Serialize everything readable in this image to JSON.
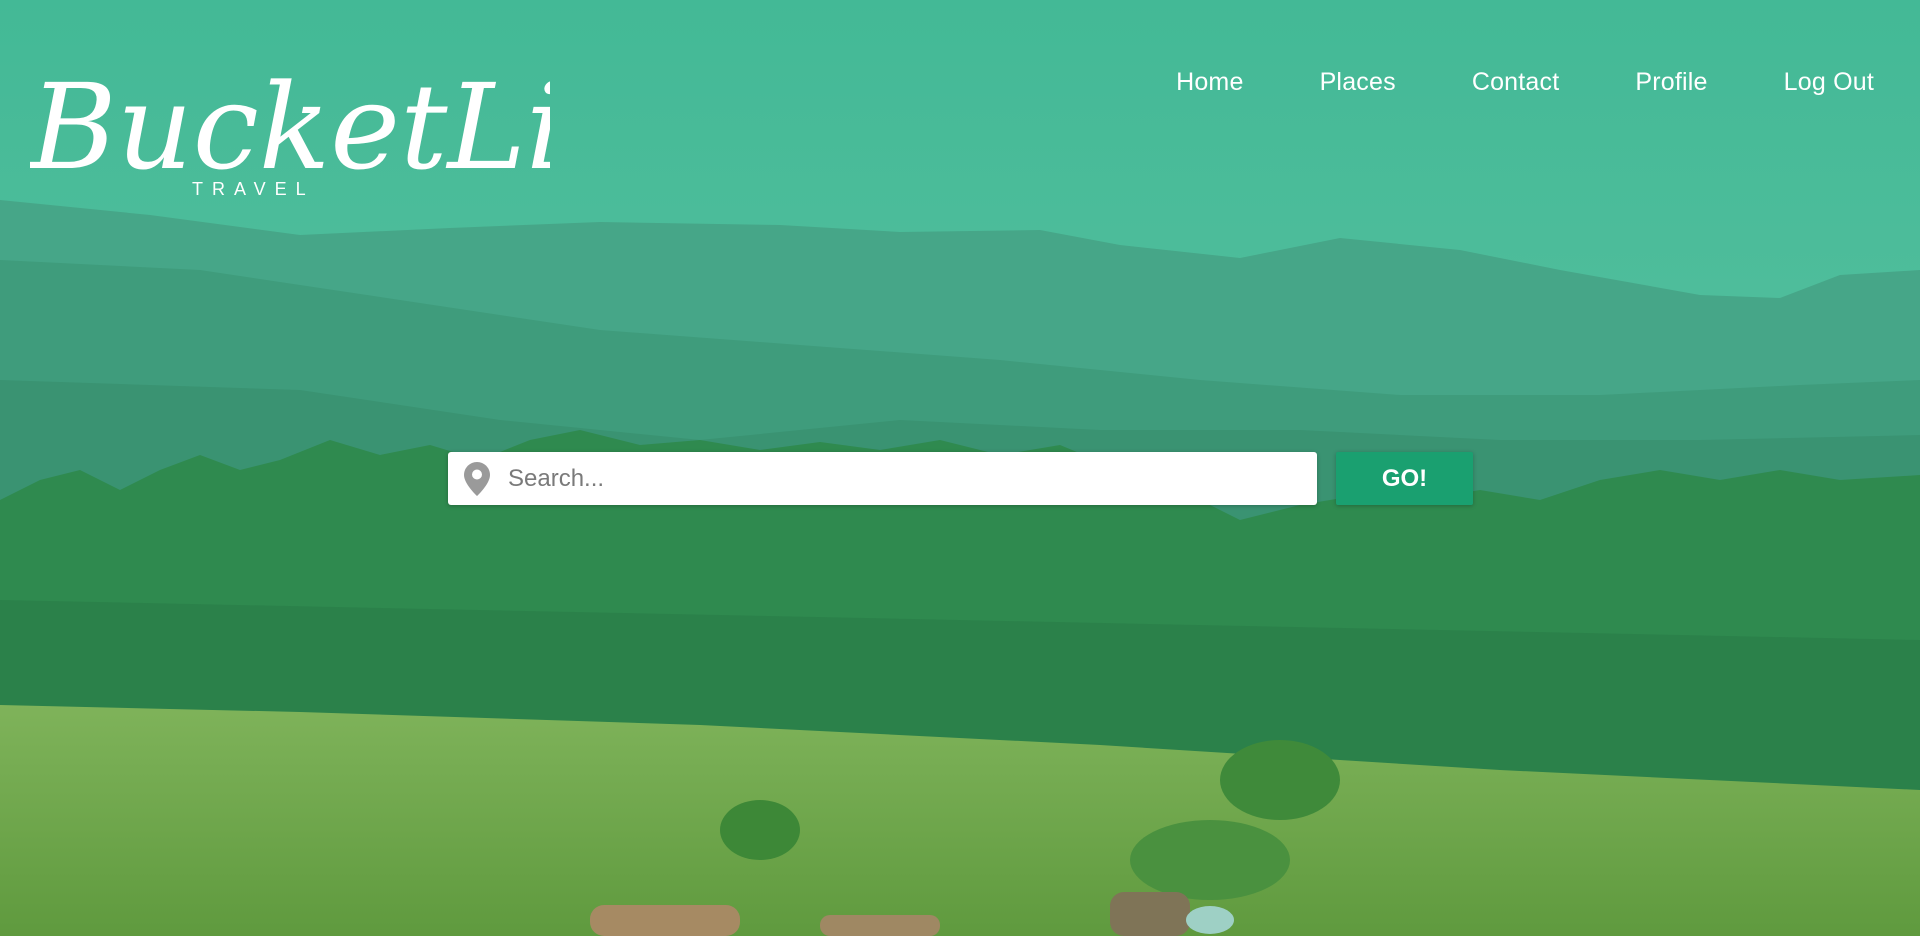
{
  "brand": {
    "logo_main": "BucketList",
    "logo_sub": "TRAVEL"
  },
  "nav": {
    "items": [
      {
        "label": "Home"
      },
      {
        "label": "Places"
      },
      {
        "label": "Contact"
      },
      {
        "label": "Profile"
      },
      {
        "label": "Log Out"
      }
    ]
  },
  "search": {
    "placeholder": "Search...",
    "value": "",
    "icon": "map-pin-icon"
  },
  "go_button": {
    "label": "GO!"
  },
  "colors": {
    "overlay_teal": "#43b996",
    "go_button": "#1aa070",
    "nav_text": "#ffffff"
  }
}
